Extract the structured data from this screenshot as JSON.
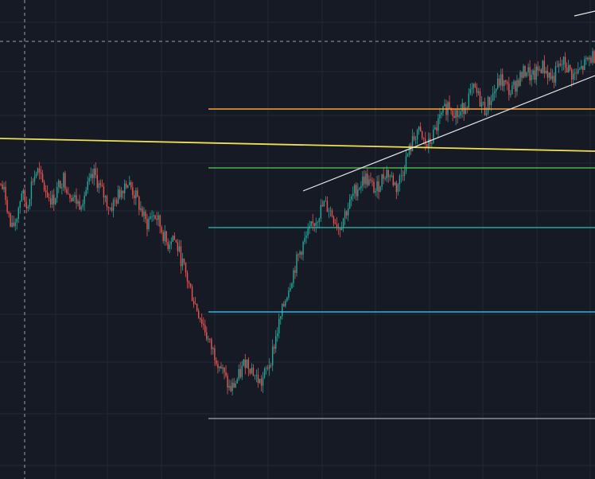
{
  "colors": {
    "background": "#161a25",
    "grid": "#242836",
    "candle_up": "#26a69a",
    "candle_down": "#ef5350",
    "crosshair": "#9aa0ad",
    "fib_orange": "#f7a13a",
    "fib_green": "#4caf50",
    "fib_teal": "#26a69a",
    "fib_cyan": "#29b6e6",
    "fib_gray": "#8a8e98",
    "yellow_trendline": "#f0e050",
    "white_trendline": "#e6e6e6"
  },
  "chart_data": {
    "type": "line",
    "description_type": "candlestick",
    "title": "",
    "xlabel": "",
    "ylabel": "",
    "grid": true,
    "series": [
      {
        "values": [
          62,
          58,
          48,
          52,
          60,
          55,
          63,
          66,
          62,
          59,
          57,
          61,
          64,
          60,
          58,
          56,
          59,
          62,
          65,
          61,
          58,
          55,
          57,
          60,
          63,
          61,
          58,
          54,
          50,
          53,
          52,
          48,
          44,
          47,
          43,
          38,
          33,
          28,
          24,
          20,
          15,
          12,
          9,
          5,
          1,
          3,
          6,
          10,
          8,
          5,
          3,
          7,
          11,
          18,
          24,
          30,
          35,
          40,
          44,
          47,
          50,
          53,
          56,
          55,
          52,
          49,
          53,
          56,
          60,
          62,
          64,
          62,
          60,
          63,
          66,
          64,
          61,
          65,
          70,
          74,
          78,
          75,
          73,
          76,
          80,
          83,
          86,
          84,
          82,
          85,
          88,
          90,
          87,
          84,
          87,
          90,
          93,
          91,
          89,
          92,
          94,
          96,
          93,
          95,
          97,
          95,
          93,
          96,
          98,
          96,
          94,
          95,
          97,
          99,
          100
        ]
      }
    ],
    "ylim": [
      0,
      100
    ]
  }
}
